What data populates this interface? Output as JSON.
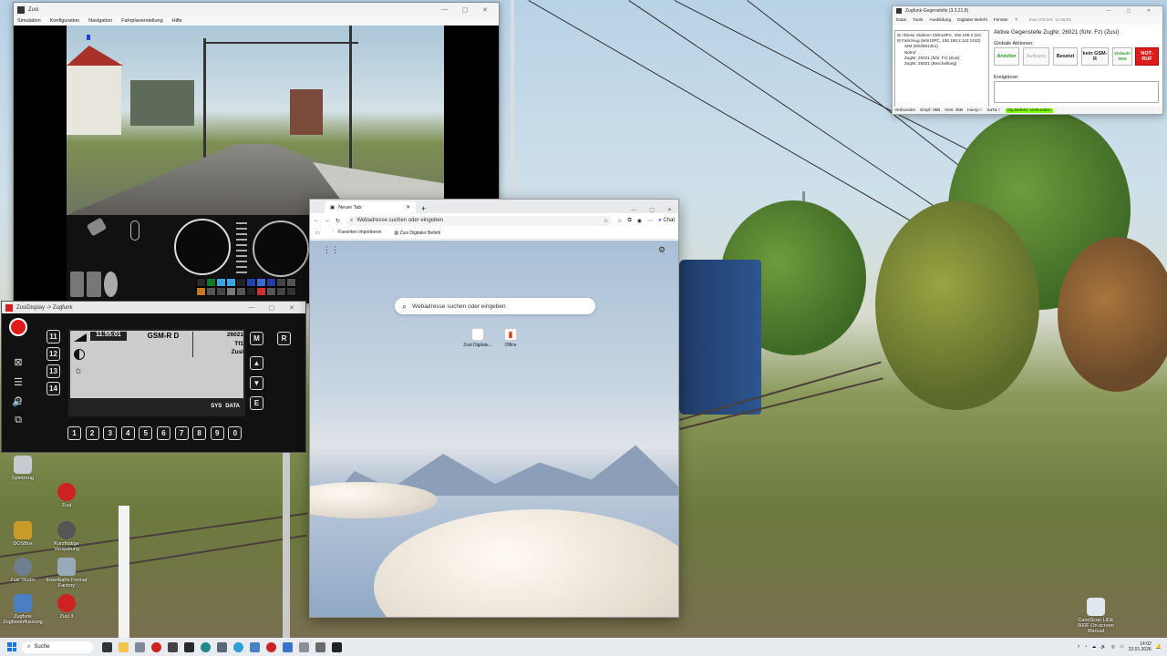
{
  "zusi": {
    "title": "Zusi",
    "menu": [
      "Simulation",
      "Konfiguration",
      "Navigation",
      "Fahrplanerstellung",
      "Hilfe"
    ]
  },
  "zugfunk": {
    "title": "ZusiDisplay -> Zugfunk",
    "time": "11:55:01",
    "system": "GSM-R D",
    "train_number": "26021",
    "line2": "Tf1",
    "line3": "Zusi",
    "left_keys": [
      "11",
      "12",
      "13",
      "14"
    ],
    "right_keys": [
      "M",
      "R",
      "E"
    ],
    "number_keys": [
      "1",
      "2",
      "3",
      "4",
      "5",
      "6",
      "7",
      "8",
      "9",
      "0"
    ],
    "bottom_labels": [
      "SYS",
      "DATA"
    ]
  },
  "edge": {
    "tab_title": "Neuer Tab",
    "address_placeholder": "Webadresse suchen oder eingeben",
    "chat_label": "Chat",
    "favorites": [
      "Favoriten importieren",
      "Zusi Digitaler Befehl"
    ],
    "search_placeholder": "Webadresse suchen oder eingeben",
    "shortcuts": [
      "Zusi Digitale...",
      "Office"
    ]
  },
  "gegenstelle": {
    "title": "Zugfunk-Gegenstelle (3.3.21.8)",
    "menu": [
      "Datei",
      "Tools",
      "Ausbildung",
      "Digitaler Befehl",
      "Fenster",
      "?"
    ],
    "clock": "Zusi Uhrzeit: 11:55:01",
    "heading": "Aktive Gegenstelle ZugNr. 26021 (führ. Fz) (Zusi)",
    "global_actions": "Globale Aktionen:",
    "tree": [
      "⊟ <Diese Station> (Win10PC, 192.168.2.110:",
      "⊟ Fahrzeug (Win10PC, 192.168.2.110:1443)",
      "   SIM (000/961451)",
      "   Notruf",
      "   ZugNr. 26021 (führ. Fz) (Zusi)",
      "   ZugNr. 26021 (Beschaltung)"
    ],
    "buttons": [
      "Anrufen",
      "Auflegen",
      "Besetzt",
      "kein GSM-R",
      "Zielwahl SMS",
      "NOT-RUF"
    ],
    "events_label": "Ereignisse:",
    "status": [
      "Verbunden",
      "Empf: 0kB",
      "Ges: 0kB",
      "HaAp:○",
      "SaTa:○",
      "Dig.Befehl: Verbunden"
    ]
  },
  "desktop_icons": [
    "Spielzeug",
    "Zusi",
    "DOSBox",
    "Kurzfristige Verspätung",
    "Zusi Studio",
    "Eisenbahn Format Factory",
    "Zugfunk Zugbeeinflussung",
    "Zusi 3",
    "CanoScan LiDE 600F On-screen Manual"
  ],
  "taskbar": {
    "search": "Suche",
    "time": "14:02",
    "date": "23.01.2026"
  },
  "colors": {
    "zf_bg": "#111111",
    "notruf": "#e01b1b",
    "green_status": "#7fff00"
  }
}
